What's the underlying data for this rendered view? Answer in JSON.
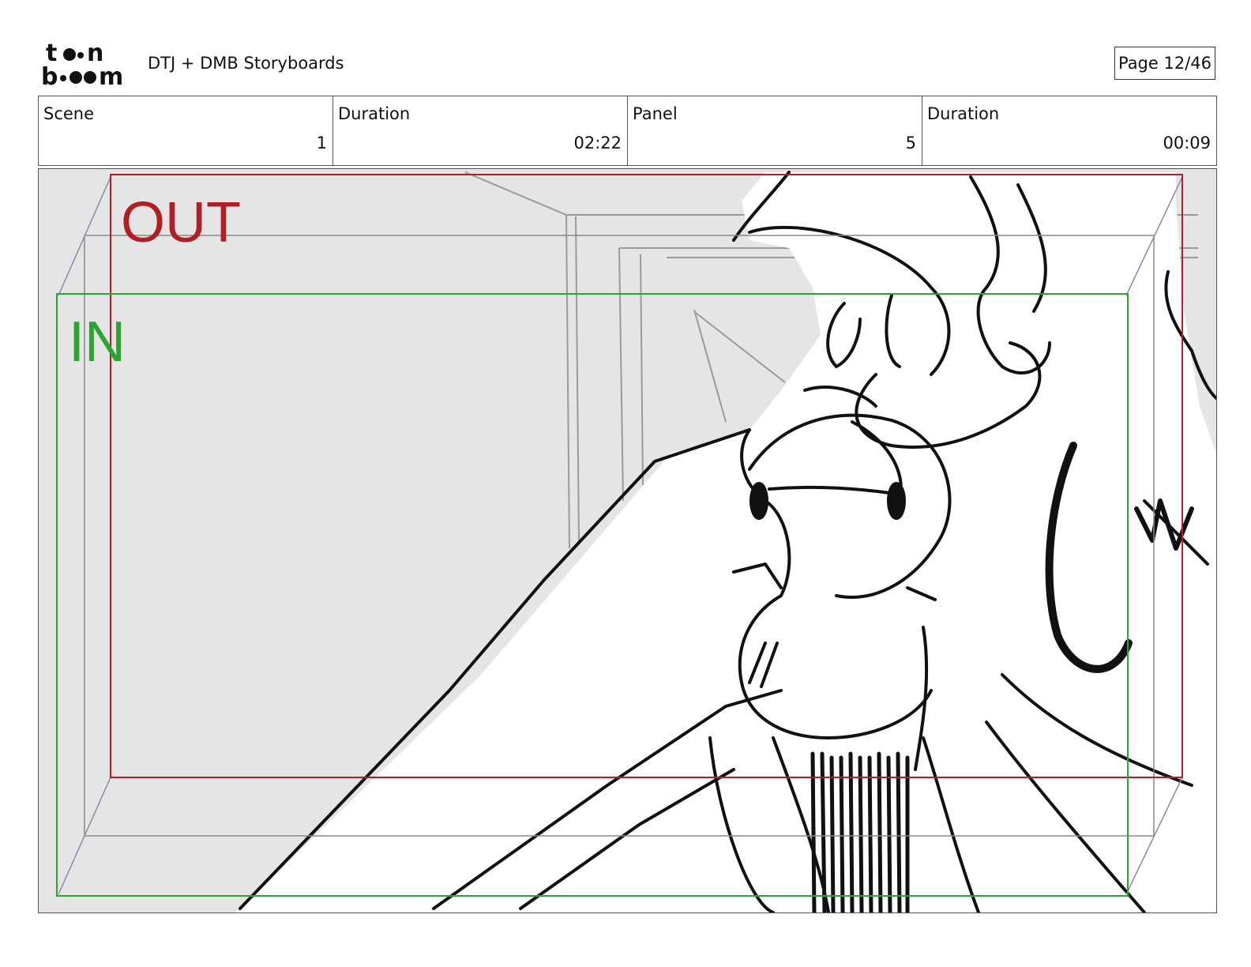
{
  "header": {
    "logo_alt": "toon boom",
    "title": "DTJ + DMB Storyboards",
    "page": "Page 12/46"
  },
  "info": [
    {
      "label": "Scene",
      "value": "1"
    },
    {
      "label": "Duration",
      "value": "02:22"
    },
    {
      "label": "Panel",
      "value": "5"
    },
    {
      "label": "Duration",
      "value": "00:09"
    }
  ],
  "panel": {
    "out_label": "OUT",
    "in_label": "IN",
    "colors": {
      "out_frame": "#b01f24",
      "in_frame": "#2aa52f",
      "guide": "#8a8aa8",
      "background": "#e5e5e5"
    }
  }
}
